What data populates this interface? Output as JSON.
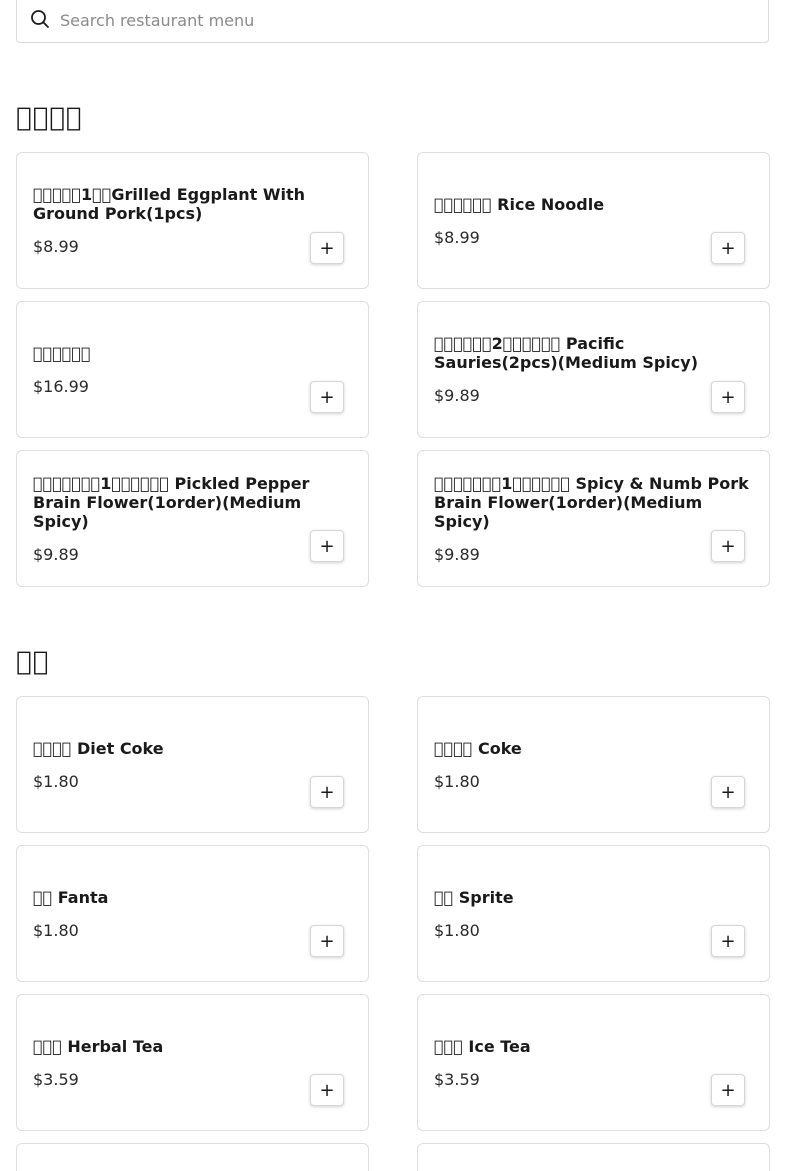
{
  "search": {
    "placeholder": "Search restaurant menu",
    "value": ""
  },
  "sections": [
    {
      "title": "􏰀􏰀􏰀􏰀",
      "items": [
        {
          "name": "􏰀􏰀􏰀􏰀􏰀1􏰀􏰀Grilled Eggplant With Ground Pork(1pcs)",
          "price": "$8.99"
        },
        {
          "name": "􏰀􏰀􏰀􏰀􏰀􏰀 Rice Noodle",
          "price": "$8.99"
        },
        {
          "name": "􏰀􏰀􏰀􏰀􏰀􏰀",
          "price": "$16.99"
        },
        {
          "name": "􏰀􏰀􏰀􏰀􏰀􏰀2􏰀􏰀􏰀􏰀􏰀􏰀 Pacific Sauries(2pcs)(Medium Spicy)",
          "price": "$9.89"
        },
        {
          "name": "􏰀􏰀􏰀􏰀􏰀􏰀􏰀1􏰀􏰀􏰀􏰀􏰀􏰀 Pickled Pepper Brain Flower(1order)(Medium Spicy)",
          "price": "$9.89"
        },
        {
          "name": "􏰀􏰀􏰀􏰀􏰀􏰀􏰀1􏰀􏰀􏰀􏰀􏰀􏰀 Spicy & Numb Pork Brain Flower(1order)(Medium Spicy)",
          "price": "$9.89"
        }
      ]
    },
    {
      "title": "􏰀􏰀",
      "items": [
        {
          "name": "􏰀􏰀􏰀􏰀 Diet Coke",
          "price": "$1.80"
        },
        {
          "name": "􏰀􏰀􏰀􏰀 Coke",
          "price": "$1.80"
        },
        {
          "name": "􏰀􏰀 Fanta",
          "price": "$1.80"
        },
        {
          "name": "􏰀􏰀 Sprite",
          "price": "$1.80"
        },
        {
          "name": "􏰀􏰀􏰀 Herbal Tea",
          "price": "$3.59"
        },
        {
          "name": "􏰀􏰀􏰀 Ice Tea",
          "price": "$3.59"
        }
      ]
    }
  ],
  "add_button_label": "+"
}
